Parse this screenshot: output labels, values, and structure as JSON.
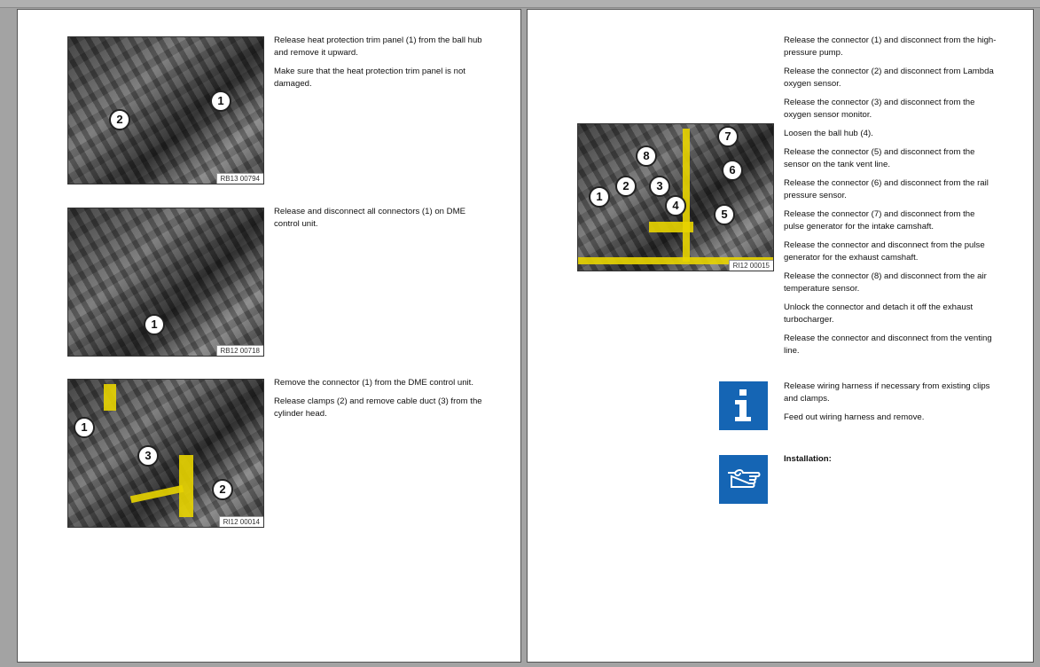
{
  "left_page": {
    "steps": [
      {
        "caption": "RB13 00794",
        "callouts": [
          "1",
          "2"
        ],
        "paragraphs": [
          "Release heat protection trim panel (1) from the ball hub and remove it upward.",
          "Make sure that the heat protection trim panel is not damaged."
        ]
      },
      {
        "caption": "RB12 00718",
        "callouts": [
          "1"
        ],
        "paragraphs": [
          "Release and disconnect all connectors (1) on DME control unit."
        ]
      },
      {
        "caption": "RI12 00014",
        "callouts": [
          "1",
          "3",
          "2"
        ],
        "paragraphs": [
          "Remove the connector (1) from the DME control unit.",
          "Release clamps (2) and remove cable duct (3) from the cylinder head."
        ]
      }
    ]
  },
  "right_page": {
    "figure": {
      "caption": "RI12 00015",
      "callouts": [
        "7",
        "8",
        "6",
        "1",
        "2",
        "3",
        "4",
        "5"
      ]
    },
    "paragraphs": [
      "Release the connector (1) and disconnect from the high-pressure pump.",
      "Release the connector (2) and disconnect from Lambda oxygen sensor.",
      "Release the connector (3) and disconnect from the oxygen sensor monitor.",
      "Loosen the ball hub (4).",
      "Release the connector (5) and disconnect from the sensor on the tank vent line.",
      "Release the connector (6) and disconnect from the rail pressure sensor.",
      "Release the connector (7) and disconnect from the pulse generator for the intake camshaft.",
      "Release the connector and disconnect from the pulse generator for the exhaust camshaft.",
      "Release the connector (8) and disconnect from the air temperature sensor.",
      "Unlock the connector and detach it off the exhaust turbocharger.",
      "Release the connector and disconnect from the venting line."
    ],
    "note": {
      "icon": "info-icon",
      "paragraphs": [
        "Release wiring harness if necessary from existing clips and clamps.",
        "Feed out wiring harness and remove."
      ]
    },
    "installation": {
      "icon": "pointing-hand-icon",
      "label": "Installation:"
    },
    "icon_color": "#1565b4"
  }
}
